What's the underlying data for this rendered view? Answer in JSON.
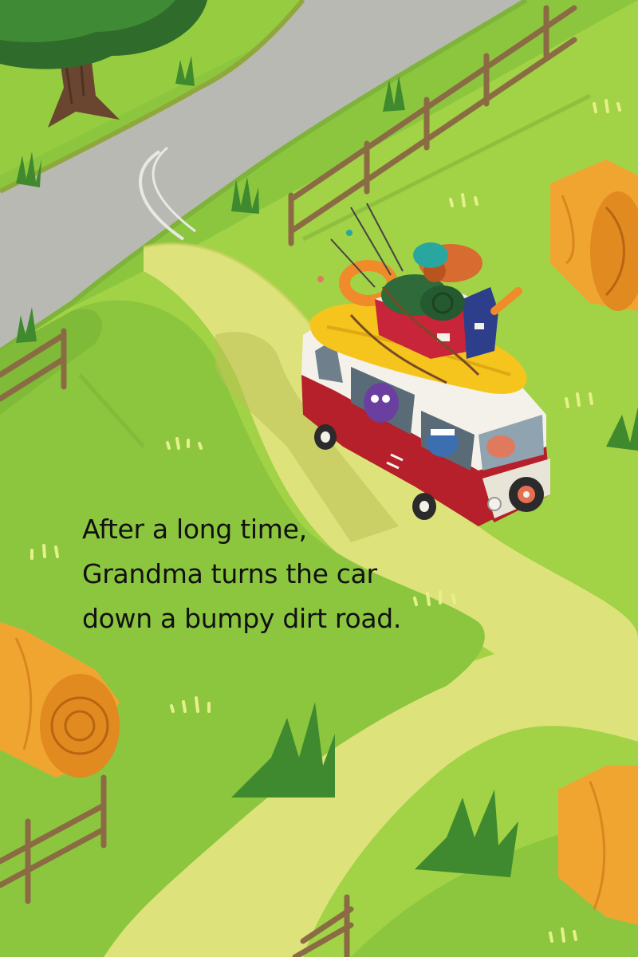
{
  "story": {
    "lines": [
      "After a long time,",
      "Grandma turns the car",
      "down a bumpy dirt road."
    ]
  },
  "colors": {
    "grass_light": "#a6d444",
    "grass_mid": "#8cc63f",
    "grass_dark": "#6fae2e",
    "paved_road": "#b9b9b3",
    "dirt_road": "#dde37a",
    "hay": "#f0a531",
    "bus_red": "#b5202a",
    "bus_white": "#f4f1ea",
    "fence": "#8b6b43",
    "text": "#111111"
  },
  "scene": {
    "icons": [
      "tree-icon",
      "fence-icon",
      "hay-bale-icon",
      "camper-van-icon",
      "luggage-icon",
      "fishing-rod-icon",
      "grass-tuft-icon"
    ]
  }
}
